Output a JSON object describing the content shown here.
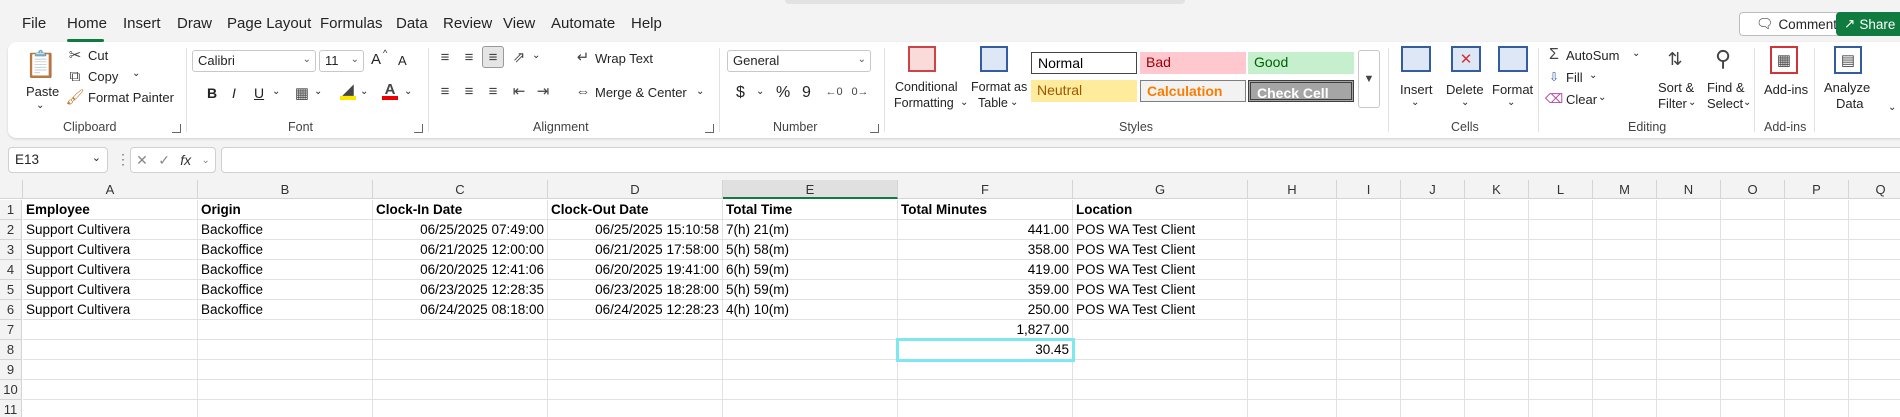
{
  "menu": {
    "tabs": [
      "File",
      "Home",
      "Insert",
      "Draw",
      "Page Layout",
      "Formulas",
      "Data",
      "Review",
      "View",
      "Automate",
      "Help"
    ],
    "comments_label": "Comments",
    "share_label": "Share"
  },
  "ribbon": {
    "clipboard": {
      "paste": "Paste",
      "cut": "Cut",
      "copy": "Copy",
      "format_painter": "Format Painter",
      "label": "Clipboard"
    },
    "font": {
      "font_name": "Calibri",
      "font_size": "11",
      "grow": "A",
      "shrink": "A",
      "bold": "B",
      "italic": "I",
      "underline": "U",
      "label": "Font"
    },
    "alignment": {
      "wrap_text": "Wrap Text",
      "merge_center": "Merge & Center",
      "label": "Alignment"
    },
    "number": {
      "format": "General",
      "currency": "$",
      "percent": "%",
      "comma": "9",
      "label": "Number"
    },
    "styles": {
      "conditional": "Conditional",
      "formatting": "Formatting",
      "format_as": "Format as",
      "table": "Table",
      "normal": "Normal",
      "bad": "Bad",
      "good": "Good",
      "neutral": "Neutral",
      "calculation": "Calculation",
      "check_cell": "Check Cell",
      "label": "Styles"
    },
    "cells": {
      "insert": "Insert",
      "delete": "Delete",
      "format": "Format",
      "label": "Cells"
    },
    "editing": {
      "autosum": "AutoSum",
      "fill": "Fill",
      "clear": "Clear",
      "sort_filter_1": "Sort &",
      "sort_filter_2": "Filter",
      "find_1": "Find &",
      "find_2": "Select",
      "label": "Editing"
    },
    "addins": {
      "addins": "Add-ins",
      "label": "Add-ins"
    },
    "analyze": {
      "line1": "Analyze",
      "line2": "Data"
    }
  },
  "formula_bar": {
    "name_box": "E13",
    "fx": "fx",
    "formula": ""
  },
  "sheet": {
    "columns": [
      "A",
      "B",
      "C",
      "D",
      "E",
      "F",
      "G",
      "H",
      "I",
      "J",
      "K",
      "L",
      "M",
      "N",
      "O",
      "P",
      "Q"
    ],
    "rows": [
      "1",
      "2",
      "3",
      "4",
      "5",
      "6",
      "7",
      "8",
      "9",
      "10",
      "11"
    ],
    "header": {
      "A": "Employee",
      "B": "Origin",
      "C": "Clock-In Date",
      "D": "Clock-Out Date",
      "E": "Total Time",
      "F": "Total Minutes",
      "G": "Location"
    },
    "data": [
      {
        "A": "Support Cultivera",
        "B": "Backoffice",
        "C": "06/25/2025 07:49:00",
        "D": "06/25/2025 15:10:58",
        "E": "7(h) 21(m)",
        "F": "441.00",
        "G": "POS WA Test Client"
      },
      {
        "A": "Support Cultivera",
        "B": "Backoffice",
        "C": "06/21/2025 12:00:00",
        "D": "06/21/2025 17:58:00",
        "E": "5(h) 58(m)",
        "F": "358.00",
        "G": "POS WA Test Client"
      },
      {
        "A": "Support Cultivera",
        "B": "Backoffice",
        "C": "06/20/2025 12:41:06",
        "D": "06/20/2025 19:41:00",
        "E": "6(h) 59(m)",
        "F": "419.00",
        "G": "POS WA Test Client"
      },
      {
        "A": "Support Cultivera",
        "B": "Backoffice",
        "C": "06/23/2025 12:28:35",
        "D": "06/23/2025 18:28:00",
        "E": "5(h) 59(m)",
        "F": "359.00",
        "G": "POS WA Test Client"
      },
      {
        "A": "Support Cultivera",
        "B": "Backoffice",
        "C": "06/24/2025 08:18:00",
        "D": "06/24/2025 12:28:23",
        "E": "4(h) 10(m)",
        "F": "250.00",
        "G": "POS WA Test Client"
      }
    ],
    "total_minutes": "1,827.00",
    "total_hours": "30.45"
  },
  "colors": {
    "accent": "#0f7b3f",
    "selection": "#7de8ef",
    "bad_bg": "#ffc7ce",
    "good_bg": "#c6efce",
    "neutral_bg": "#ffeb9c"
  }
}
